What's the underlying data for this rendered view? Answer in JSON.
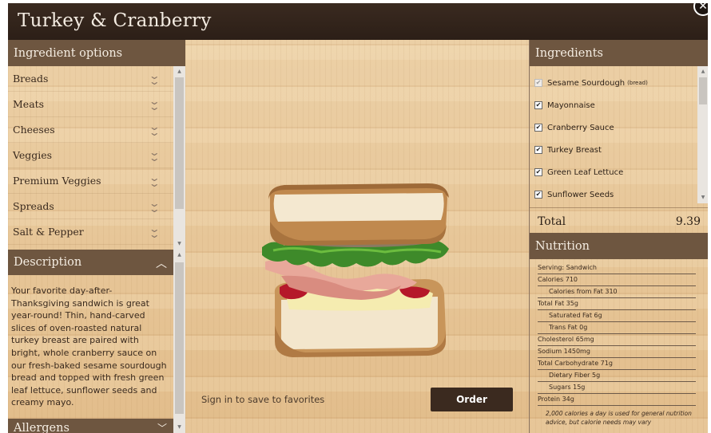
{
  "title": "Turkey & Cranberry",
  "options": {
    "header": "Ingredient options",
    "items": [
      "Breads",
      "Meats",
      "Cheeses",
      "Veggies",
      "Premium Veggies",
      "Spreads",
      "Salt & Pepper"
    ]
  },
  "description": {
    "header": "Description",
    "text": "Your favorite day-after-Thanksgiving sandwich is great year-round! Thin, hand-carved slices of oven-roasted natural turkey breast are paired with bright, whole cranberry sauce on our fresh-baked sesame sourdough bread and topped with fresh green leaf lettuce, sunflower seeds and creamy mayo."
  },
  "allergens": {
    "header": "Allergens"
  },
  "center": {
    "signin": "Sign in to save to favorites",
    "order": "Order"
  },
  "ingredients": {
    "header": "Ingredients",
    "items": [
      {
        "name": "Sesame Sourdough",
        "tag": "(bread)",
        "checked": true,
        "disabled": true
      },
      {
        "name": "Mayonnaise",
        "tag": "",
        "checked": true,
        "disabled": false
      },
      {
        "name": "Cranberry Sauce",
        "tag": "",
        "checked": true,
        "disabled": false
      },
      {
        "name": "Turkey Breast",
        "tag": "",
        "checked": true,
        "disabled": false
      },
      {
        "name": "Green Leaf Lettuce",
        "tag": "",
        "checked": true,
        "disabled": false
      },
      {
        "name": "Sunflower Seeds",
        "tag": "",
        "checked": true,
        "disabled": false
      }
    ]
  },
  "total": {
    "label": "Total",
    "value": "9.39"
  },
  "nutrition": {
    "header": "Nutrition",
    "rows": [
      {
        "text": "Serving: Sandwich",
        "indent": false
      },
      {
        "text": "Calories 710",
        "indent": false
      },
      {
        "text": "Calories from Fat 310",
        "indent": true
      },
      {
        "text": "Total Fat 35g",
        "indent": false
      },
      {
        "text": "Saturated Fat 6g",
        "indent": true
      },
      {
        "text": "Trans Fat 0g",
        "indent": true
      },
      {
        "text": "Cholesterol 65mg",
        "indent": false
      },
      {
        "text": "Sodium 1450mg",
        "indent": false
      },
      {
        "text": "Total Carbohydrate 71g",
        "indent": false
      },
      {
        "text": "Dietary Fiber 5g",
        "indent": true
      },
      {
        "text": "Sugars 15g",
        "indent": true
      },
      {
        "text": "Protein 34g",
        "indent": false
      }
    ],
    "note": "2,000 calories a day is used for general nutrition advice, but calorie needs may vary"
  },
  "colors": {
    "titlebar": "#2c1f17",
    "section_header": "#6e5640",
    "order_button": "#3b2a1f",
    "wood": "#e6c597"
  },
  "icons": {
    "close": "close-icon",
    "expand": "chevron-double-down-icon",
    "collapse": "chevron-up-icon",
    "check": "checkmark-icon"
  }
}
